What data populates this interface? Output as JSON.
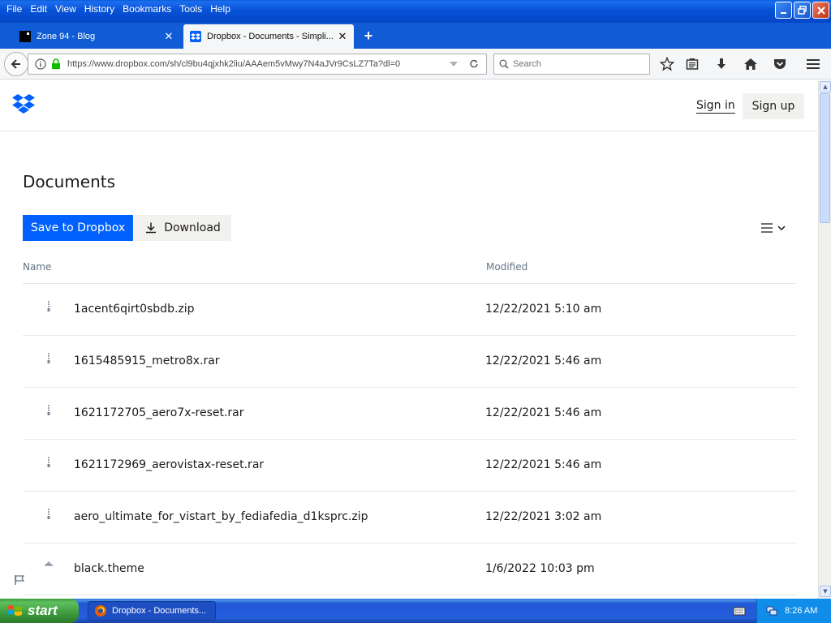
{
  "window": {
    "menu": [
      "File",
      "Edit",
      "View",
      "History",
      "Bookmarks",
      "Tools",
      "Help"
    ]
  },
  "tabs": [
    {
      "title": "Zone 94 - Blog",
      "active": false
    },
    {
      "title": "Dropbox - Documents - Simpli...",
      "active": true
    }
  ],
  "navbar": {
    "url": "https://www.dropbox.com/sh/cl9bu4qjxhk2liu/AAAem5vMwy7N4aJVr9CsLZ7Ta?dl=0",
    "search_placeholder": "Search"
  },
  "dropbox": {
    "sign_in": "Sign in",
    "sign_up": "Sign up",
    "folder_title": "Documents",
    "save_button": "Save to Dropbox",
    "download_button": "Download",
    "columns": {
      "name": "Name",
      "modified": "Modified"
    },
    "files": [
      {
        "name": "1acent6qirt0sbdb.zip",
        "modified": "12/22/2021 5:10 am",
        "icon": "zip-file-icon"
      },
      {
        "name": "1615485915_metro8x.rar",
        "modified": "12/22/2021 5:46 am",
        "icon": "zip-file-icon"
      },
      {
        "name": "1621172705_aero7x-reset.rar",
        "modified": "12/22/2021 5:46 am",
        "icon": "zip-file-icon"
      },
      {
        "name": "1621172969_aerovistax-reset.rar",
        "modified": "12/22/2021 5:46 am",
        "icon": "zip-file-icon"
      },
      {
        "name": "aero_ultimate_for_vistart_by_fediafedia_d1ksprc.zip",
        "modified": "12/22/2021 3:02 am",
        "icon": "zip-file-icon"
      },
      {
        "name": "black.theme",
        "modified": "1/6/2022 10:03 pm",
        "icon": "theme-file-icon"
      }
    ]
  },
  "taskbar": {
    "start_label": "start",
    "task_label": "Dropbox - Documents...",
    "clock": "8:26 AM"
  },
  "colors": {
    "dropbox_blue": "#0061fe",
    "xp_title_blue": "#0752d6",
    "start_green": "#379337"
  }
}
